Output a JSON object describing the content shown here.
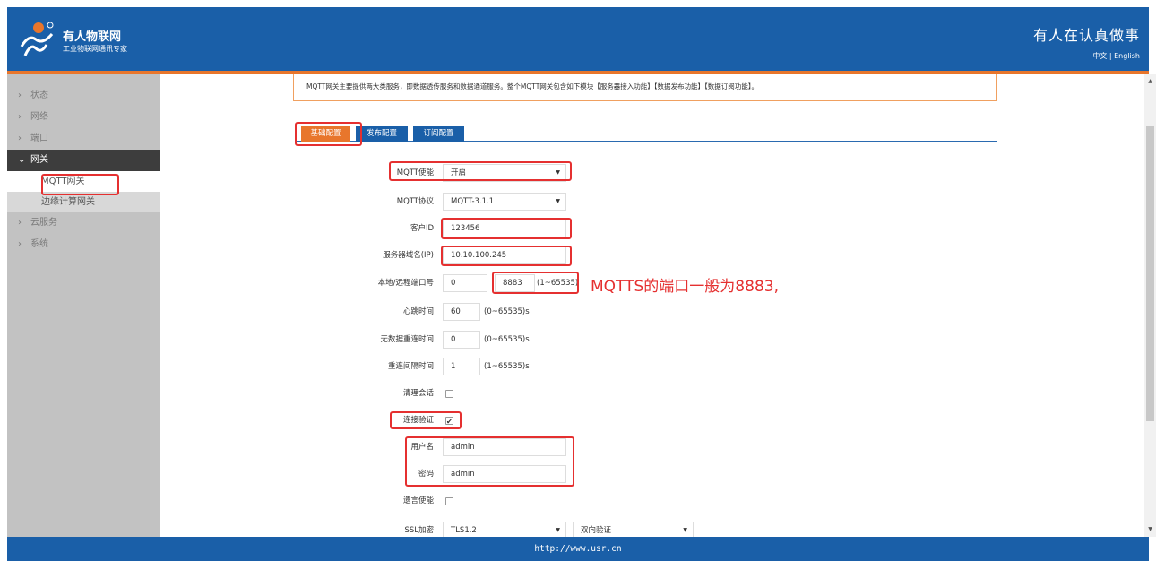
{
  "header": {
    "brand_title": "有人物联网",
    "brand_subtitle": "工业物联网通讯专家",
    "slogan": "有人在认真做事",
    "lang_zh": "中文",
    "lang_separator": " | ",
    "lang_en": "English"
  },
  "sidebar": {
    "items": [
      {
        "label": "状态"
      },
      {
        "label": "网络"
      },
      {
        "label": "端口"
      },
      {
        "label": "网关"
      },
      {
        "label": "云服务"
      },
      {
        "label": "系统"
      }
    ],
    "sub_items": [
      {
        "label": "MQTT网关"
      },
      {
        "label": "边缘计算网关"
      }
    ]
  },
  "info": "MQTT网关主要提供两大类服务，即数据透传服务和数据通道服务。整个MQTT网关包含如下模块【服务器接入功能】【数据发布功能】【数据订阅功能】。",
  "tabs": [
    {
      "label": "基础配置"
    },
    {
      "label": "发布配置"
    },
    {
      "label": "订阅配置"
    }
  ],
  "form": {
    "mqtt_enable": {
      "label": "MQTT使能",
      "value": "开启"
    },
    "mqtt_protocol": {
      "label": "MQTT协议",
      "value": "MQTT-3.1.1"
    },
    "client_id": {
      "label": "客户ID",
      "value": "123456"
    },
    "server": {
      "label": "服务器域名(IP)",
      "value": "10.10.100.245"
    },
    "ports": {
      "label": "本地/远程端口号",
      "local": "0",
      "remote": "8883",
      "range": "(1~65535)"
    },
    "heartbeat": {
      "label": "心跳时间",
      "value": "60",
      "range": "(0~65535)s"
    },
    "no_data_reconnect": {
      "label": "无数据重连时间",
      "value": "0",
      "range": "(0~65535)s"
    },
    "reconnect_interval": {
      "label": "重连间隔时间",
      "value": "1",
      "range": "(1~65535)s"
    },
    "clean_session": {
      "label": "清理会话",
      "checked": false
    },
    "auth": {
      "label": "连接验证",
      "checked": true
    },
    "username": {
      "label": "用户名",
      "value": "admin"
    },
    "password": {
      "label": "密码",
      "value": "admin"
    },
    "will_enable": {
      "label": "遗言使能",
      "checked": false
    },
    "ssl": {
      "label": "SSL加密",
      "value": "TLS1.2",
      "mode": "双向验证"
    }
  },
  "annotation": "MQTTS的端口一般为8883,",
  "footer": "http://www.usr.cn",
  "colors": {
    "brand_blue": "#1a5fa8",
    "accent_orange": "#e8762c",
    "highlight_red": "#e53030"
  }
}
